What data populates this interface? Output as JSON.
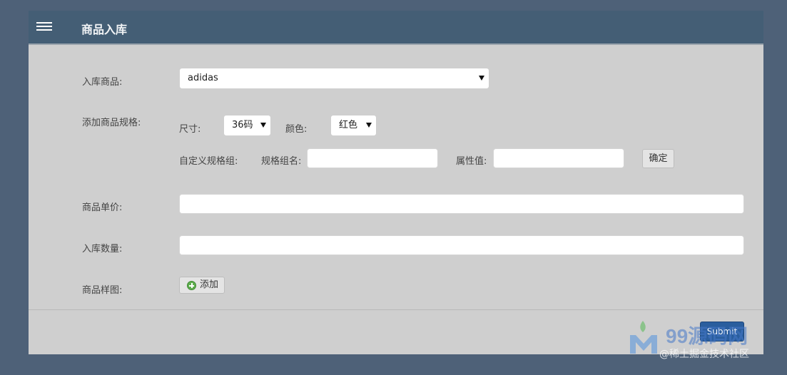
{
  "header": {
    "title": "商品入库"
  },
  "form": {
    "product": {
      "label": "入库商品:",
      "value": "adidas"
    },
    "spec": {
      "label": "添加商品规格:",
      "size_label": "尺寸:",
      "size_value": "36码",
      "color_label": "颜色:",
      "color_value": "红色",
      "custom_group_label": "自定义规格组:",
      "group_name_label": "规格组名:",
      "group_name_value": "",
      "attr_value_label": "属性值:",
      "attr_value_value": "",
      "confirm_label": "确定"
    },
    "price": {
      "label": "商品单价:",
      "value": ""
    },
    "quantity": {
      "label": "入库数量:",
      "value": ""
    },
    "image": {
      "label": "商品样图:",
      "add_label": "添加"
    }
  },
  "footer": {
    "submit_label": "Submit"
  },
  "watermark": {
    "text": "99源码网",
    "subtext": "@稀土掘金技术社区"
  },
  "colors": {
    "page_bg": "#4e6178",
    "header_bg": "#445e75",
    "panel_bg": "#cfcfcf",
    "submit_bg": "#2a5e9e",
    "add_icon": "#5fae4f"
  }
}
